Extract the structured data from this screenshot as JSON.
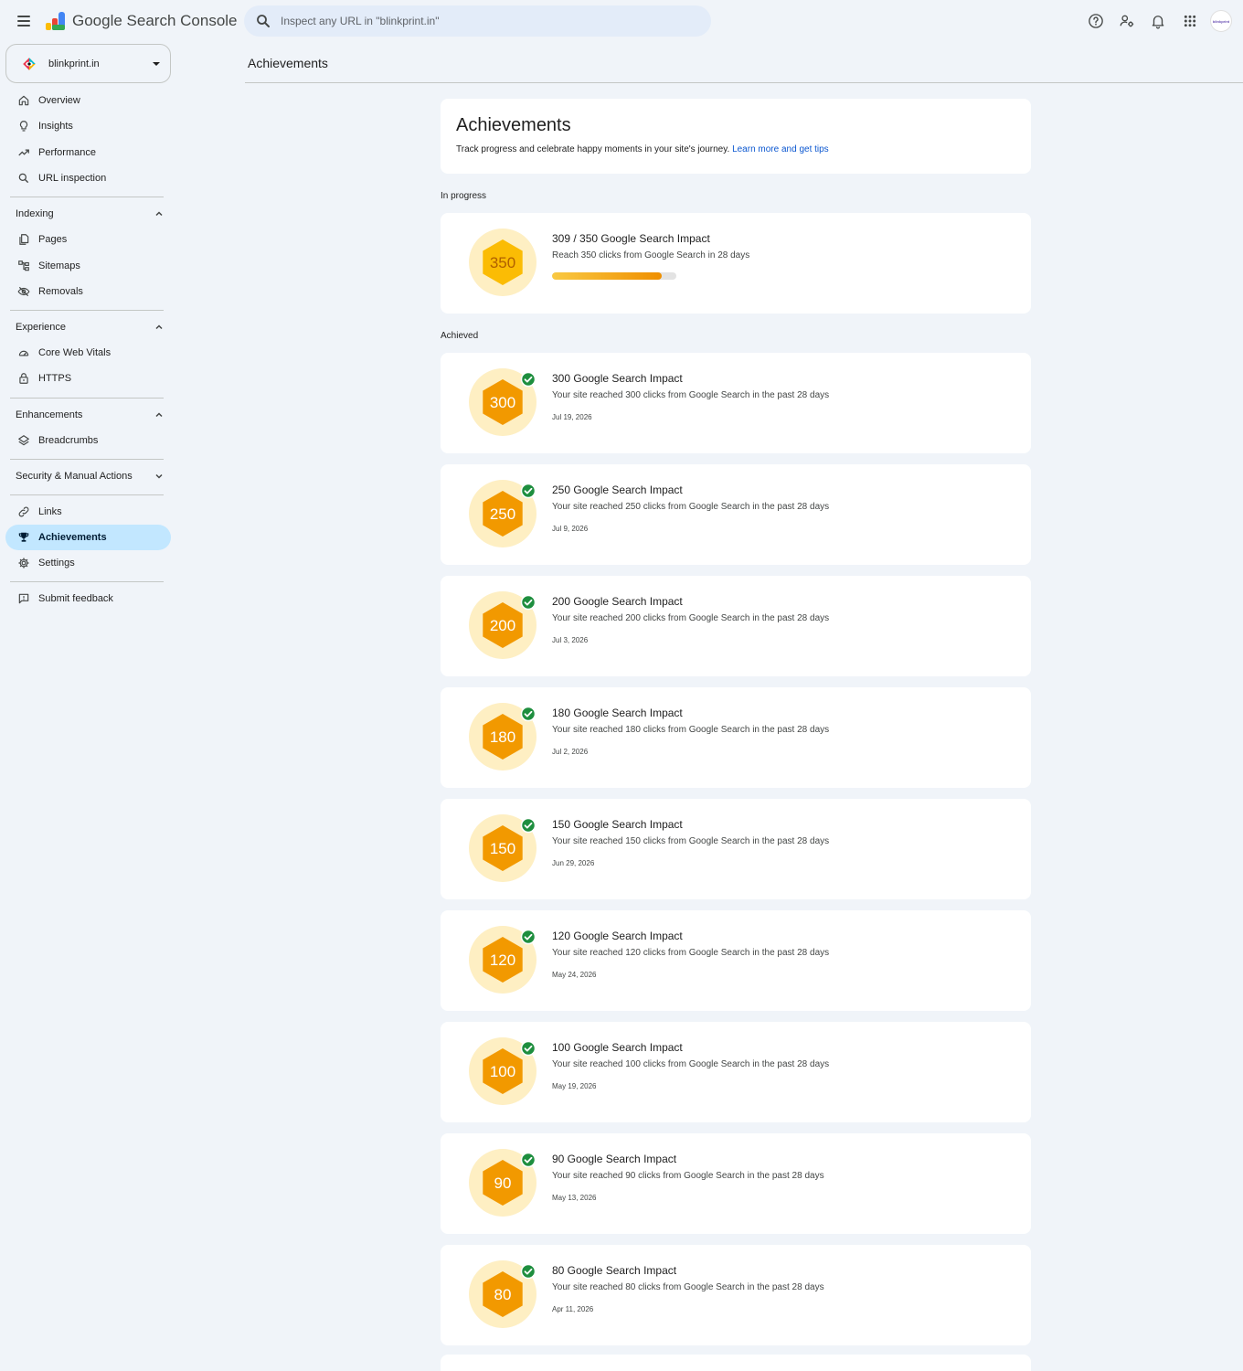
{
  "app": {
    "title": "Google Search Console",
    "search_placeholder": "Inspect any URL in \"blinkprint.in\"",
    "avatar_text": "blinkprint"
  },
  "property": {
    "name": "blinkprint.in"
  },
  "sidebar": {
    "top_items": [
      {
        "label": "Overview",
        "icon": "home-icon"
      },
      {
        "label": "Insights",
        "icon": "lightbulb-icon"
      },
      {
        "label": "Performance",
        "icon": "trending-up-icon"
      },
      {
        "label": "URL inspection",
        "icon": "search-icon"
      }
    ],
    "indexing": {
      "label": "Indexing",
      "items": [
        {
          "label": "Pages",
          "icon": "pages-icon"
        },
        {
          "label": "Sitemaps",
          "icon": "sitemap-icon"
        },
        {
          "label": "Removals",
          "icon": "visibility-off-icon"
        }
      ]
    },
    "experience": {
      "label": "Experience",
      "items": [
        {
          "label": "Core Web Vitals",
          "icon": "speed-icon"
        },
        {
          "label": "HTTPS",
          "icon": "lock-icon"
        }
      ]
    },
    "enhancements": {
      "label": "Enhancements",
      "items": [
        {
          "label": "Breadcrumbs",
          "icon": "layers-icon"
        }
      ]
    },
    "security": {
      "label": "Security & Manual Actions"
    },
    "bottom_items": [
      {
        "label": "Links",
        "icon": "link-icon"
      },
      {
        "label": "Achievements",
        "icon": "trophy-icon",
        "active": true
      },
      {
        "label": "Settings",
        "icon": "settings-icon"
      }
    ],
    "feedback": {
      "label": "Submit feedback",
      "icon": "feedback-icon"
    }
  },
  "main": {
    "page_title": "Achievements",
    "header": {
      "title": "Achievements",
      "subtitle": "Track progress and celebrate happy moments in your site's journey.",
      "link": "Learn more and get tips"
    },
    "in_progress_label": "In progress",
    "in_progress": {
      "badge": "350",
      "title": "309 / 350 Google Search Impact",
      "desc": "Reach 350 clicks from Google Search in 28 days",
      "current": 309,
      "target": 350
    },
    "achieved_label": "Achieved",
    "achieved": [
      {
        "badge": "300",
        "title": "300 Google Search Impact",
        "desc": "Your site reached 300 clicks from Google Search in the past 28 days",
        "date": "Jul 19, 2026"
      },
      {
        "badge": "250",
        "title": "250 Google Search Impact",
        "desc": "Your site reached 250 clicks from Google Search in the past 28 days",
        "date": "Jul 9, 2026"
      },
      {
        "badge": "200",
        "title": "200 Google Search Impact",
        "desc": "Your site reached 200 clicks from Google Search in the past 28 days",
        "date": "Jul 3, 2026"
      },
      {
        "badge": "180",
        "title": "180 Google Search Impact",
        "desc": "Your site reached 180 clicks from Google Search in the past 28 days",
        "date": "Jul 2, 2026"
      },
      {
        "badge": "150",
        "title": "150 Google Search Impact",
        "desc": "Your site reached 150 clicks from Google Search in the past 28 days",
        "date": "Jun 29, 2026"
      },
      {
        "badge": "120",
        "title": "120 Google Search Impact",
        "desc": "Your site reached 120 clicks from Google Search in the past 28 days",
        "date": "May 24, 2026"
      },
      {
        "badge": "100",
        "title": "100 Google Search Impact",
        "desc": "Your site reached 100 clicks from Google Search in the past 28 days",
        "date": "May 19, 2026"
      },
      {
        "badge": "90",
        "title": "90 Google Search Impact",
        "desc": "Your site reached 90 clicks from Google Search in the past 28 days",
        "date": "May 13, 2026"
      },
      {
        "badge": "80",
        "title": "80 Google Search Impact",
        "desc": "Your site reached 80 clicks from Google Search in the past 28 days",
        "date": "Apr 11, 2026"
      }
    ]
  },
  "colors": {
    "accent_blue": "#0b57d0",
    "active_nav": "#c2e7ff",
    "badge_halo": "#feefc3",
    "badge_in_progress": "#fbbc04",
    "badge_achieved": "#f29900",
    "check_green": "#1e8e3e"
  }
}
